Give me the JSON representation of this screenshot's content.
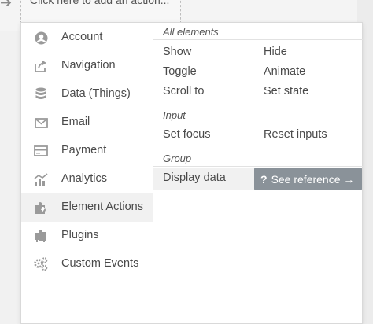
{
  "header": {
    "add_action_text": "Click here to add an action..."
  },
  "categories": [
    {
      "label": "Account",
      "icon": "account-icon"
    },
    {
      "label": "Navigation",
      "icon": "navigation-icon"
    },
    {
      "label": "Data (Things)",
      "icon": "database-icon"
    },
    {
      "label": "Email",
      "icon": "email-icon"
    },
    {
      "label": "Payment",
      "icon": "payment-icon"
    },
    {
      "label": "Analytics",
      "icon": "analytics-icon"
    },
    {
      "label": "Element Actions",
      "icon": "element-actions-icon",
      "selected": true
    },
    {
      "label": "Plugins",
      "icon": "plugins-icon"
    },
    {
      "label": "Custom Events",
      "icon": "custom-events-icon"
    }
  ],
  "sections": {
    "all_elements": {
      "title": "All elements",
      "actions": [
        "Show",
        "Hide",
        "Toggle",
        "Animate",
        "Scroll to",
        "Set state"
      ]
    },
    "input": {
      "title": "Input",
      "actions": [
        "Set focus",
        "Reset inputs"
      ]
    },
    "group": {
      "title": "Group",
      "actions": [
        "Display data"
      ]
    }
  },
  "see_reference": {
    "icon": "?",
    "label": "See reference →"
  },
  "colors": {
    "icon": "#9a9a9a",
    "active_bg": "#f1f1f1",
    "reference_bg": "#8a9299"
  }
}
